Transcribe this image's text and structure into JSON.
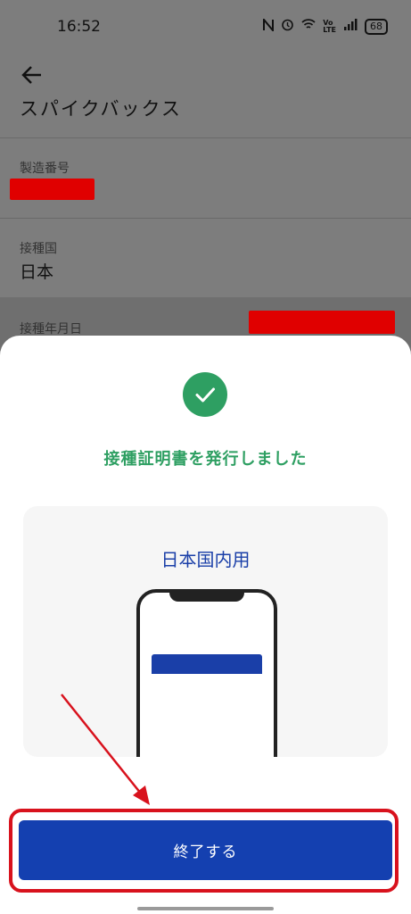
{
  "status_bar": {
    "time": "16:52",
    "battery": "68",
    "icons": [
      "nfc-icon",
      "alarm-icon",
      "wifi-icon",
      "volte-icon",
      "signal-icon",
      "battery-icon"
    ]
  },
  "background": {
    "partial_title": "スパイクバックス",
    "fields": [
      {
        "label": "製造番号",
        "value": ""
      },
      {
        "label": "接種国",
        "value": "日本"
      },
      {
        "label": "接種年月日",
        "value": ""
      }
    ]
  },
  "sheet": {
    "title": "接種証明書を発行しました",
    "card_label": "日本国内用",
    "finish_button": "終了する"
  },
  "colors": {
    "success_green": "#2e9f62",
    "primary_blue": "#1440b0",
    "highlight_red": "#d8121d"
  }
}
